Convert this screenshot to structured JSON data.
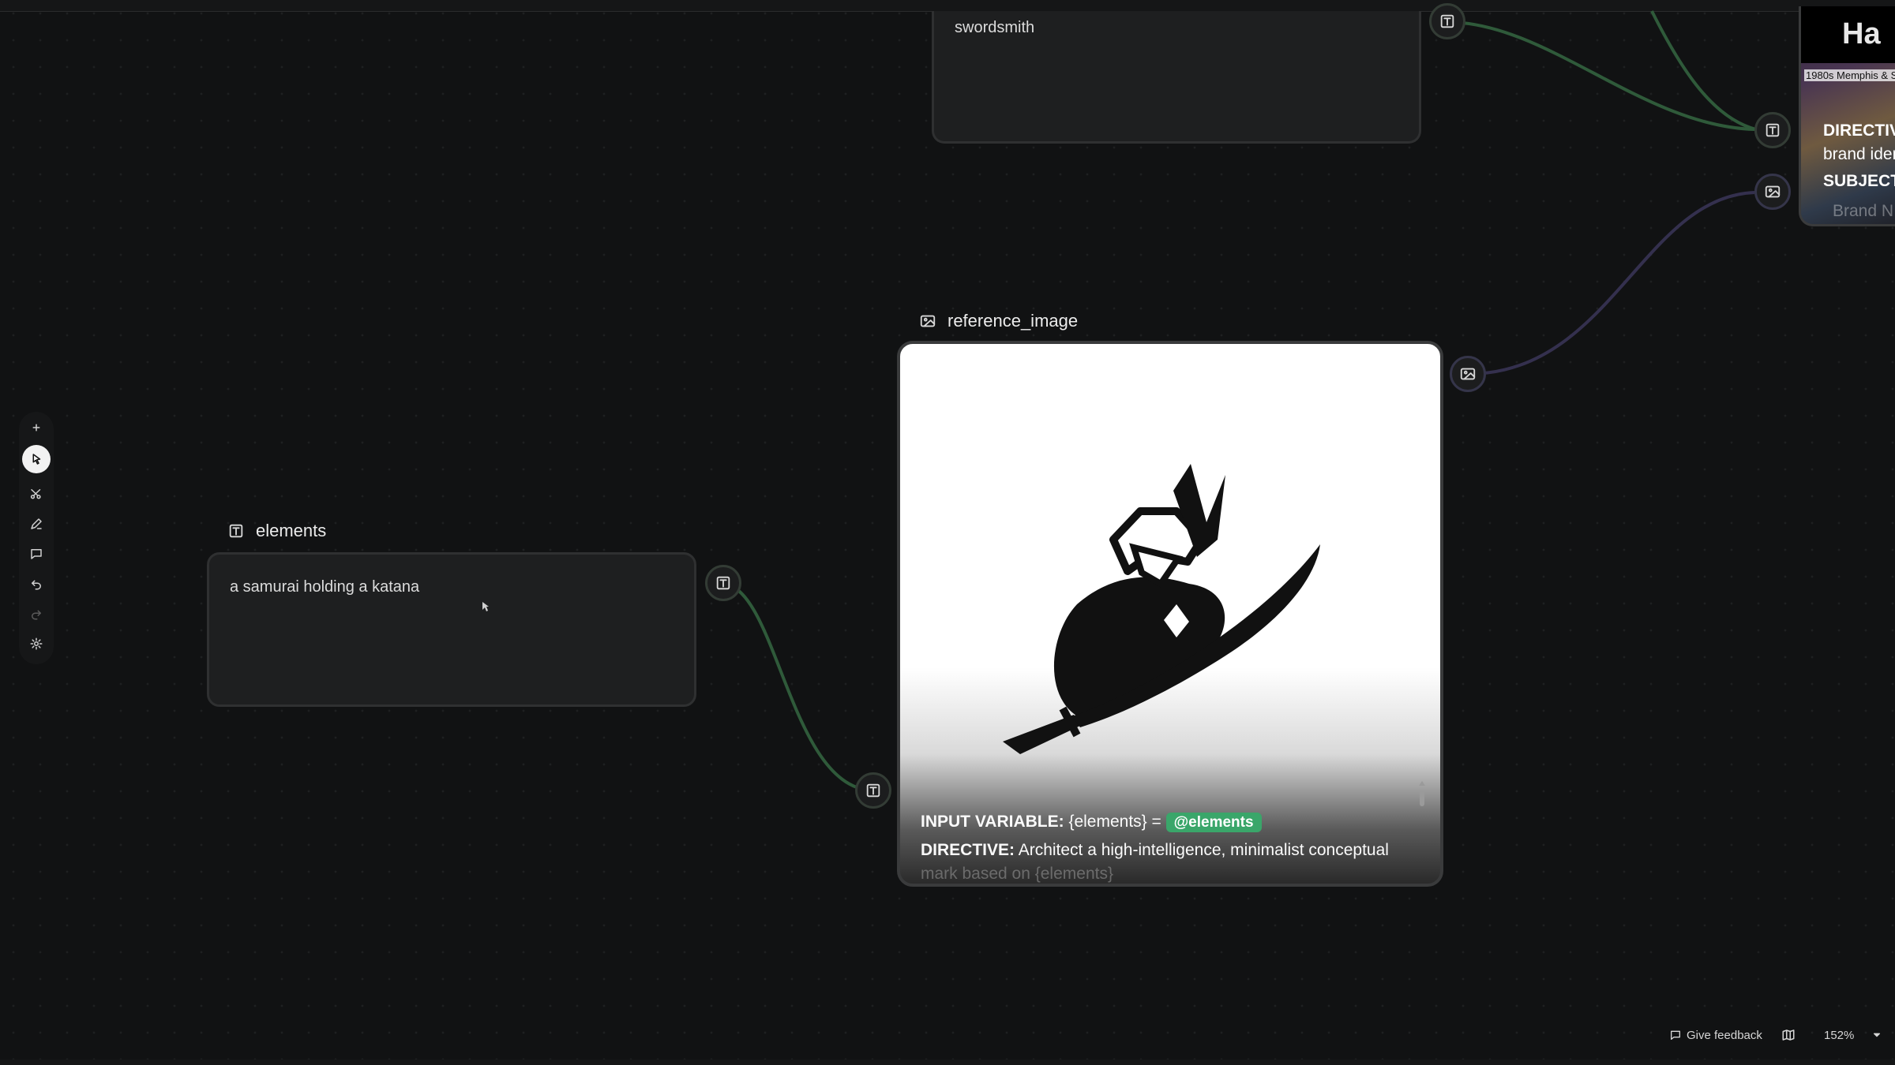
{
  "canvas": {
    "wire_colors": {
      "text": "#2f5a3a",
      "image": "#34304e"
    }
  },
  "toolbar": {
    "tools": [
      {
        "name": "add",
        "icon": "plus-icon"
      },
      {
        "name": "select",
        "icon": "pointer-icon",
        "active": true
      },
      {
        "name": "cut",
        "icon": "scissors-icon"
      },
      {
        "name": "draw",
        "icon": "pen-icon"
      },
      {
        "name": "comment",
        "icon": "comment-icon"
      },
      {
        "name": "undo",
        "icon": "undo-icon"
      },
      {
        "name": "redo",
        "icon": "redo-icon",
        "disabled": true
      },
      {
        "name": "settings",
        "icon": "gear-icon"
      }
    ]
  },
  "nodes": {
    "top_text": {
      "value": "swordsmith"
    },
    "elements": {
      "title": "elements",
      "value": "a samurai holding a katana"
    },
    "reference_image": {
      "title": "reference_image",
      "prompt_var_label": "INPUT VARIABLE:",
      "prompt_var_value": "{elements} =",
      "prompt_tag": "@elements",
      "prompt_directive_label": "DIRECTIVE:",
      "prompt_directive_text": "Architect a high-intelligence, minimalist conceptual",
      "prompt_cutoff_text": "mark based on {elements}"
    },
    "preview": {
      "logo_text": "Ha",
      "caption": "1980s Memphis & S",
      "line1": "DIRECTIV",
      "line2": "brand ider",
      "line3": "SUBJECT",
      "line4": "Brand N"
    }
  },
  "footer": {
    "feedback_label": "Give feedback",
    "zoom_label": "152%"
  }
}
